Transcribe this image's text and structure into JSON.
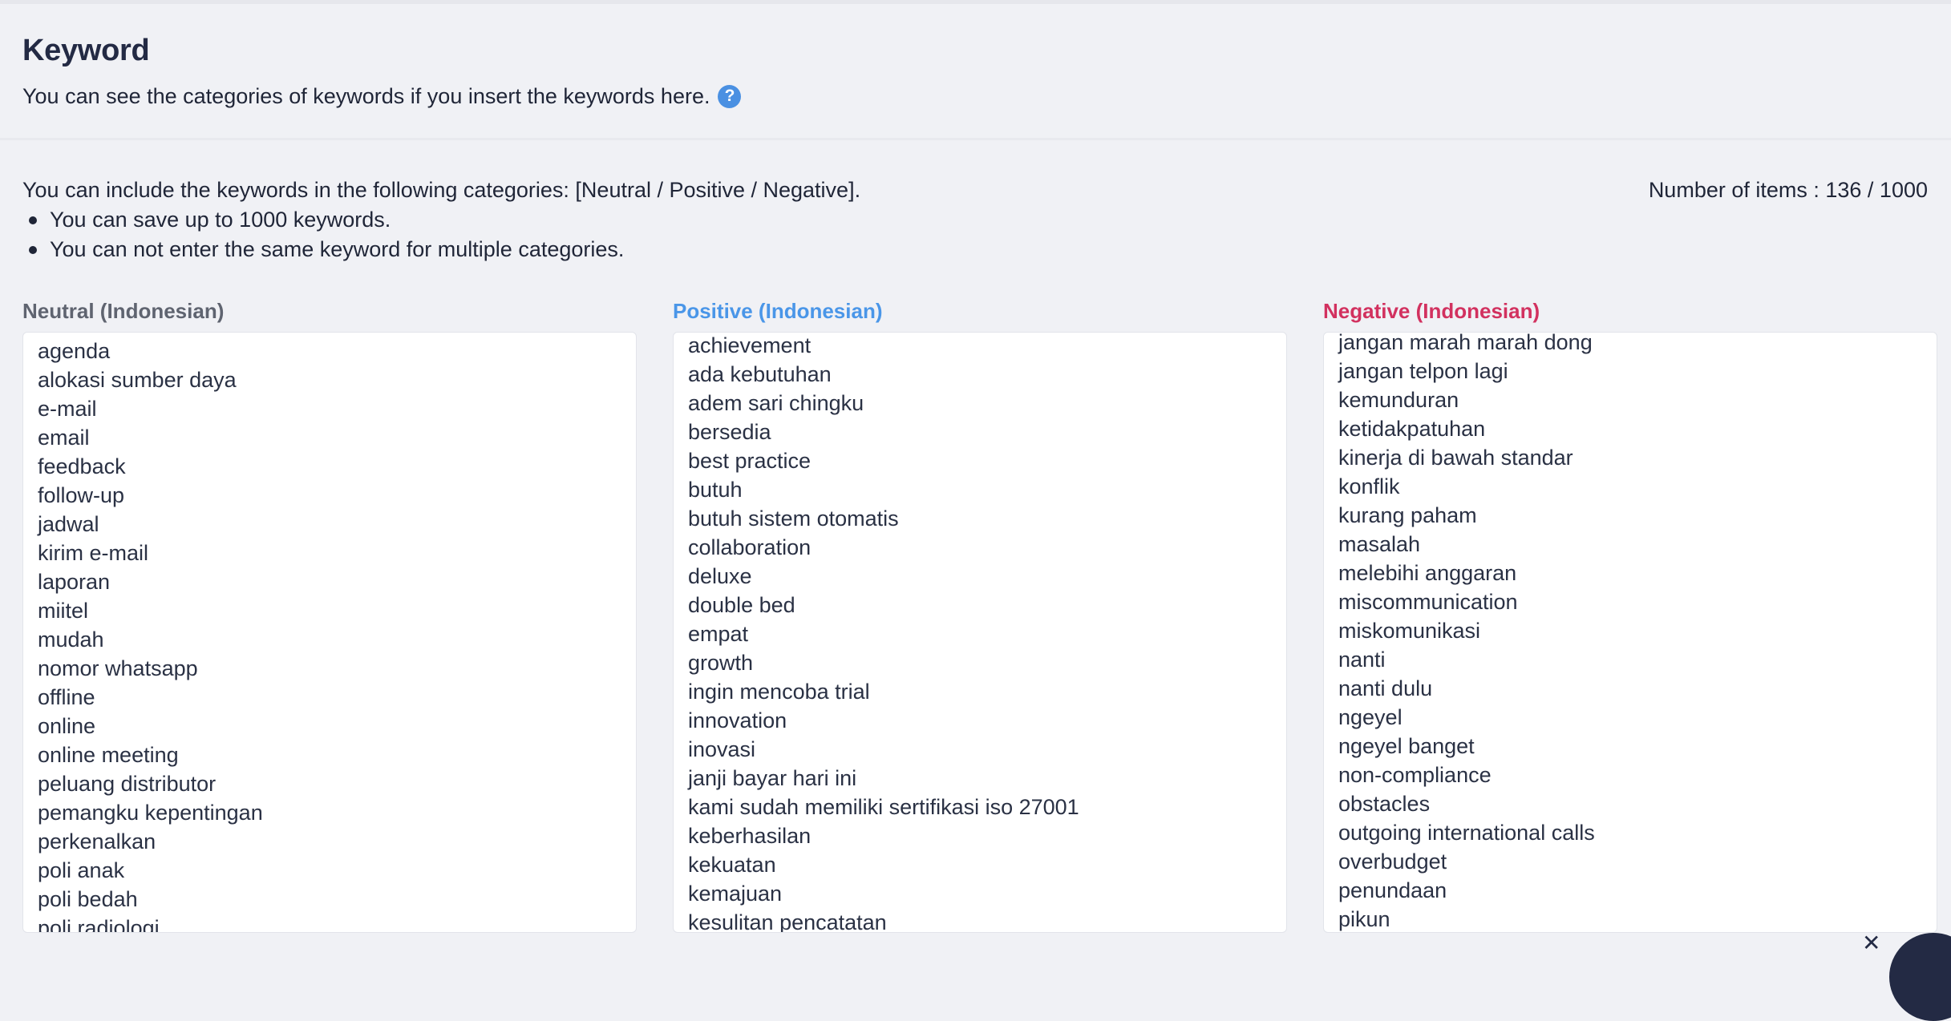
{
  "header": {
    "title": "Keyword",
    "subtitle": "You can see the categories of keywords if you insert the keywords here.",
    "help_icon": "?"
  },
  "info": {
    "intro": "You can include the keywords in the following categories: [Neutral / Positive / Negative].",
    "bullets": [
      "You can save up to 1000 keywords.",
      "You can not enter the same keyword for multiple categories."
    ],
    "count": "Number of items : 136 / 1000"
  },
  "columns": {
    "neutral": {
      "label": "Neutral (Indonesian)",
      "color": "#5f6470",
      "items": [
        "agenda",
        "alokasi sumber daya",
        "e-mail",
        "email",
        "feedback",
        "follow-up",
        "jadwal",
        "kirim e-mail",
        "laporan",
        "miitel",
        "mudah",
        "nomor whatsapp",
        "offline",
        "online",
        "online meeting",
        "peluang distributor",
        "pemangku kepentingan",
        "perkenalkan",
        "poli anak",
        "poli bedah",
        "poli radiologi"
      ]
    },
    "positive": {
      "label": "Positive (Indonesian)",
      "color": "#4a96e8",
      "items": [
        "achievement",
        "ada kebutuhan",
        "adem sari chingku",
        "bersedia",
        "best practice",
        "butuh",
        "butuh sistem otomatis",
        "collaboration",
        "deluxe",
        "double bed",
        "empat",
        "growth",
        "ingin mencoba trial",
        "innovation",
        "inovasi",
        "janji bayar hari ini",
        "kami sudah memiliki sertifikasi iso 27001",
        "keberhasilan",
        "kekuatan",
        "kemajuan",
        "kesulitan pencatatan"
      ]
    },
    "negative": {
      "label": "Negative (Indonesian)",
      "color": "#d2315f",
      "items": [
        "jangan marah marah dong",
        "jangan telpon lagi",
        "kemunduran",
        "ketidakpatuhan",
        "kinerja di bawah standar",
        "konflik",
        "kurang paham",
        "masalah",
        "melebihi anggaran",
        "miscommunication",
        "miskomunikasi",
        "nanti",
        "nanti dulu",
        "ngeyel",
        "ngeyel banget",
        "non-compliance",
        "obstacles",
        "outgoing international calls",
        "overbudget",
        "penundaan",
        "pikun"
      ]
    }
  },
  "floating": {
    "close": "✕"
  }
}
